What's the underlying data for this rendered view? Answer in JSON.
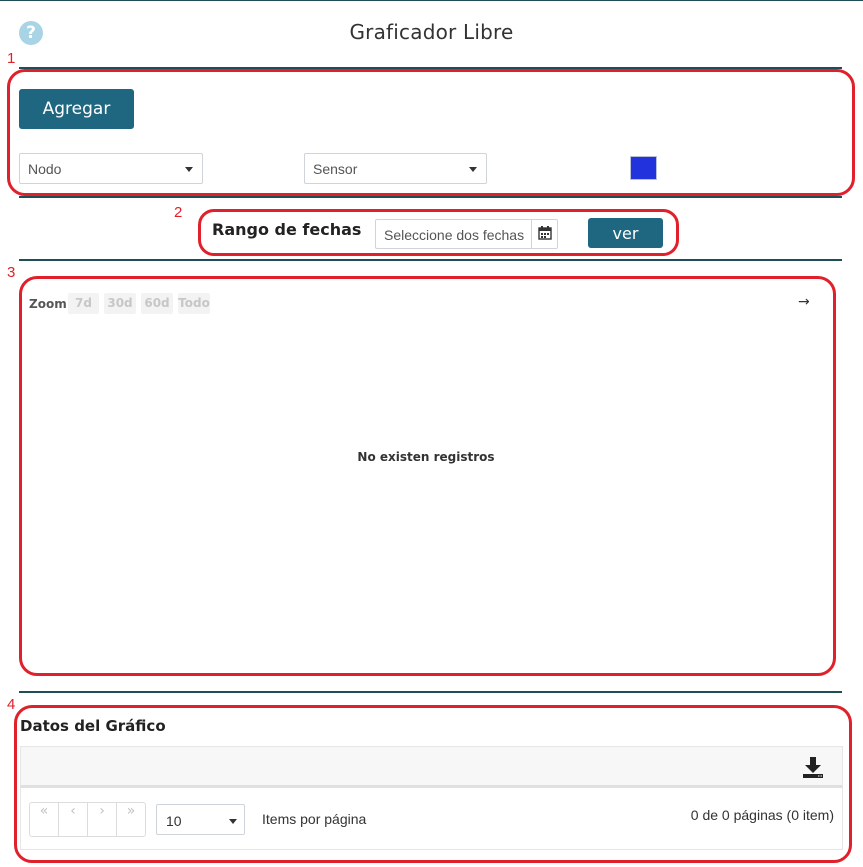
{
  "header": {
    "title": "Graficador Libre",
    "help_icon": "question-circle-icon",
    "help_glyph": "?"
  },
  "annotations": [
    "1",
    "2",
    "3",
    "4"
  ],
  "series_section": {
    "add_label": "Agregar",
    "node_select": {
      "value": "Nodo"
    },
    "sensor_select": {
      "value": "Sensor"
    },
    "series_color": "#2233dd"
  },
  "date_range": {
    "label": "Rango de fechas",
    "placeholder": "Seleccione dos fechas",
    "calendar_icon": "calendar-icon",
    "view_label": "ver"
  },
  "chart": {
    "zoom_label": "Zoom",
    "zoom_options": [
      "7d",
      "30d",
      "60d",
      "Todo"
    ],
    "arrow": "→",
    "empty_message": "No existen registros"
  },
  "table": {
    "title": "Datos del Gráfico",
    "download_icon": "download-icon",
    "pager_buttons": [
      "«",
      "‹",
      "›",
      "»"
    ],
    "per_page_value": "10",
    "per_page_label": "Items por página",
    "page_info": "0 de 0 páginas (0 item)"
  },
  "colors": {
    "accent": "#1f6680",
    "annotation": "#e0202a",
    "divider": "#1e4f57"
  }
}
